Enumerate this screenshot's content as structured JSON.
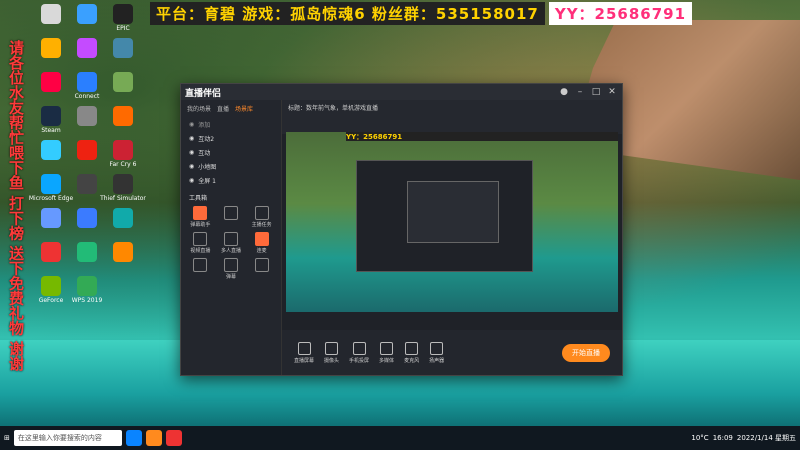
{
  "overlay": {
    "platform": "平台：育碧 游戏：孤岛惊魂6 粉丝群：535158017",
    "yy": "YY：25686791",
    "vertical": "请各位水友帮忙喂下鱼 打下榜 送下免费礼物 谢谢"
  },
  "desktop_icons": [
    {
      "label": "",
      "color": "#d9d9d9"
    },
    {
      "label": "",
      "color": "#3aa0ff"
    },
    {
      "label": "EPIC",
      "color": "#222"
    },
    {
      "label": "",
      "color": "#ffb000"
    },
    {
      "label": "",
      "color": "#c44bff"
    },
    {
      "label": "",
      "color": "#48a"
    },
    {
      "label": "",
      "color": "#f04"
    },
    {
      "label": "Connect",
      "color": "#2a7fff"
    },
    {
      "label": "",
      "color": "#7a5"
    },
    {
      "label": "Steam",
      "color": "#1a2c44"
    },
    {
      "label": "",
      "color": "#888"
    },
    {
      "label": "",
      "color": "#ff6a00"
    },
    {
      "label": "",
      "color": "#3cf"
    },
    {
      "label": "",
      "color": "#e21"
    },
    {
      "label": "Far Cry 6",
      "color": "#c23"
    },
    {
      "label": "Microsoft Edge",
      "color": "#0aa6ff"
    },
    {
      "label": "",
      "color": "#444"
    },
    {
      "label": "Thief Simulator",
      "color": "#333"
    },
    {
      "label": "",
      "color": "#69f"
    },
    {
      "label": "",
      "color": "#3b7bff"
    },
    {
      "label": "",
      "color": "#1aa"
    },
    {
      "label": "",
      "color": "#e33"
    },
    {
      "label": "",
      "color": "#2b7"
    },
    {
      "label": "",
      "color": "#f80"
    },
    {
      "label": "GeForce",
      "color": "#76b900"
    },
    {
      "label": "WPS 2019",
      "color": "#3a5"
    }
  ],
  "window": {
    "title": "直播伴侣",
    "tabs": [
      "我的场景",
      "直播",
      "场景库"
    ],
    "info": "标题：数年前气象，单机游戏直播",
    "scenes": [
      "添加",
      "互动2",
      "互动",
      "小地图",
      "全屏 1"
    ],
    "tools_title": "工具箱",
    "tools": [
      {
        "label": "弹幕助手",
        "hot": true
      },
      {
        "label": "",
        "hot": false
      },
      {
        "label": "主播任务",
        "hot": false
      },
      {
        "label": "视频直播",
        "hot": false
      },
      {
        "label": "多人直播",
        "hot": false
      },
      {
        "label": "连麦",
        "hot": true
      },
      {
        "label": "",
        "hot": false
      },
      {
        "label": "弹幕",
        "hot": false
      },
      {
        "label": "",
        "hot": false
      }
    ],
    "bottom": [
      {
        "label": "直播屏幕"
      },
      {
        "label": "摄像头"
      },
      {
        "label": "手机投屏"
      },
      {
        "label": "多媒体"
      },
      {
        "label": "麦克风"
      },
      {
        "label": "扬声器"
      }
    ],
    "start_label": "开始直播",
    "preview_banner": "YY：25686791"
  },
  "taskbar": {
    "search_placeholder": "在这里输入你要搜索的内容",
    "weather": "10°C",
    "time": "16:09",
    "date": "2022/1/14 星期五"
  }
}
